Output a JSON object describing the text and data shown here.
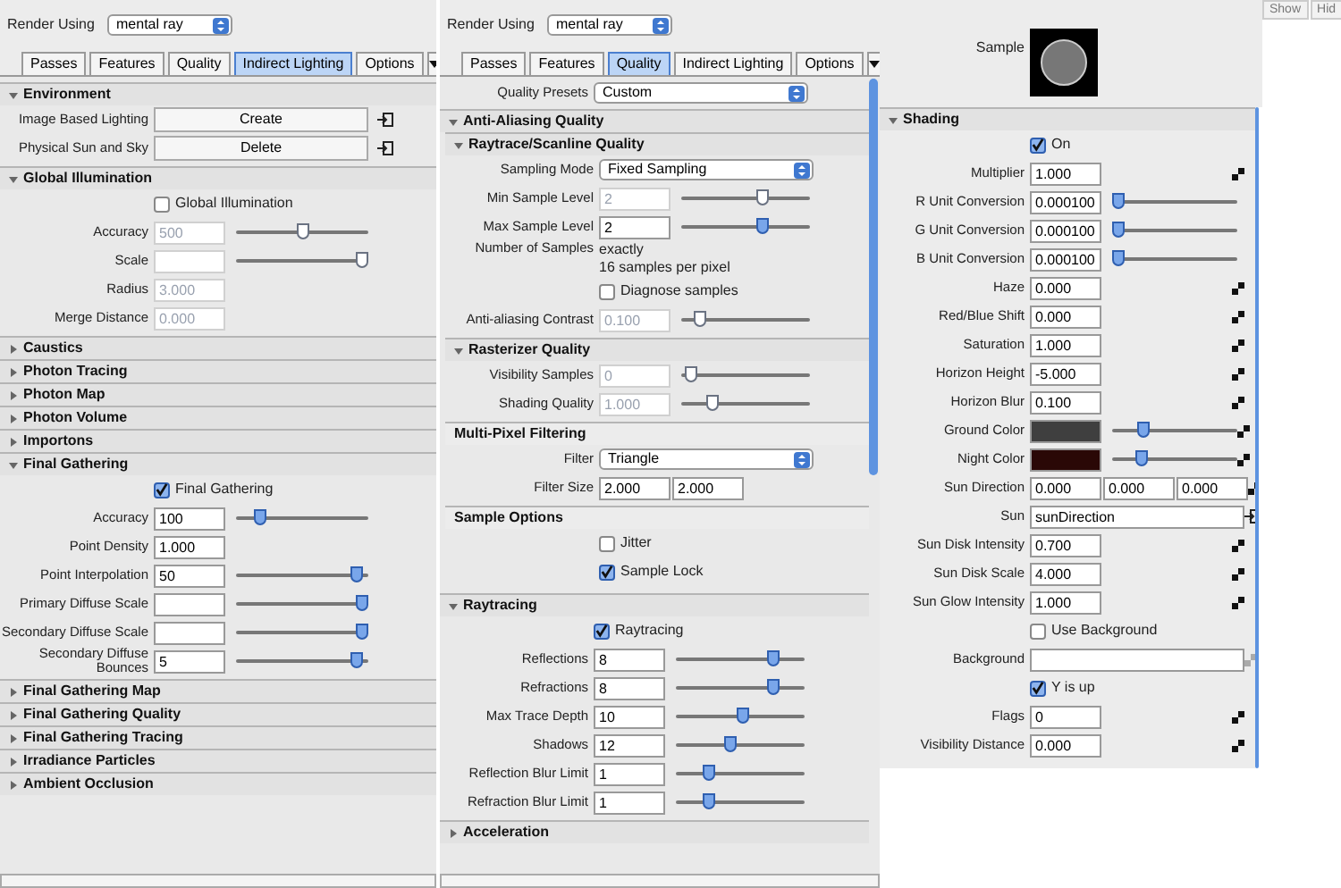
{
  "left": {
    "render_using": {
      "label": "Render Using",
      "value": "mental ray"
    },
    "tabs": [
      {
        "label": "Passes",
        "selected": false
      },
      {
        "label": "Features",
        "selected": false
      },
      {
        "label": "Quality",
        "selected": false
      },
      {
        "label": "Indirect Lighting",
        "selected": true
      },
      {
        "label": "Options",
        "selected": false
      }
    ],
    "sections": [
      {
        "kind": "rollout",
        "title": "Environment",
        "expanded": true,
        "rows": [
          {
            "kind": "button",
            "label": "Image Based Lighting",
            "value": "Create"
          },
          {
            "kind": "button",
            "label": "Physical Sun and Sky",
            "value": "Delete"
          }
        ]
      },
      {
        "kind": "rollout",
        "title": "Global Illumination",
        "expanded": true,
        "rows": [
          {
            "kind": "checkbox",
            "label": "Global Illumination",
            "checked": false
          },
          {
            "kind": "field",
            "label": "Accuracy",
            "value": "500",
            "disabled": true,
            "level": 0.5
          },
          {
            "kind": "field",
            "label": "Scale",
            "disabled": true,
            "level": 1
          },
          {
            "kind": "field",
            "label": "Radius",
            "value": "3.000",
            "disabled": true
          },
          {
            "kind": "field",
            "label": "Merge Distance",
            "value": "0.000",
            "disabled": true
          }
        ]
      },
      {
        "kind": "rollout",
        "title": "Caustics",
        "expanded": false
      },
      {
        "kind": "rollout",
        "title": "Photon Tracing",
        "expanded": false
      },
      {
        "kind": "rollout",
        "title": "Photon Map",
        "expanded": false
      },
      {
        "kind": "rollout",
        "title": "Photon Volume",
        "expanded": false
      },
      {
        "kind": "rollout",
        "title": "Importons",
        "expanded": false
      },
      {
        "kind": "rollout",
        "title": "Final Gathering",
        "expanded": true,
        "rows": [
          {
            "kind": "checkbox",
            "label": "Final Gathering",
            "checked": true
          },
          {
            "kind": "field",
            "label": "Accuracy",
            "value": "100",
            "disabled": false,
            "level": 0.15
          },
          {
            "kind": "field",
            "label": "Point Density",
            "value": "1.000",
            "disabled": false
          },
          {
            "kind": "field",
            "label": "Point Interpolation",
            "value": "50",
            "disabled": false,
            "level": 0.95
          },
          {
            "kind": "field",
            "label": "Primary Diffuse Scale",
            "disabled": false,
            "level": 1
          },
          {
            "kind": "field",
            "label": "Secondary Diffuse Scale",
            "disabled": false,
            "level": 1
          },
          {
            "kind": "field",
            "label": "Secondary Diffuse Bounces",
            "value": "5",
            "disabled": false,
            "level": 0.95
          }
        ]
      },
      {
        "kind": "rollout",
        "title": "Final Gathering Map",
        "expanded": false
      },
      {
        "kind": "rollout",
        "title": "Final Gathering Quality",
        "expanded": false
      },
      {
        "kind": "rollout",
        "title": "Final Gathering Tracing",
        "expanded": false
      },
      {
        "kind": "rollout",
        "title": "Irradiance Particles",
        "expanded": false
      },
      {
        "kind": "rollout",
        "title": "Ambient Occlusion",
        "expanded": false
      }
    ]
  },
  "middle": {
    "render_using": {
      "label": "Render Using",
      "value": "mental ray"
    },
    "tabs": [
      {
        "label": "Passes",
        "selected": false
      },
      {
        "label": "Features",
        "selected": false
      },
      {
        "label": "Quality",
        "selected": true
      },
      {
        "label": "Indirect Lighting",
        "selected": false
      },
      {
        "label": "Options",
        "selected": false
      }
    ],
    "presets": {
      "label": "Quality Presets",
      "value": "Custom"
    },
    "sections": [
      {
        "kind": "rollout",
        "title": "Anti-Aliasing Quality",
        "expanded": true,
        "children": [
          {
            "kind": "rollout",
            "title": "Raytrace/Scanline Quality",
            "expanded": true,
            "rows": [
              {
                "kind": "dropdown",
                "label": "Sampling Mode",
                "value": "Fixed Sampling"
              },
              {
                "kind": "field",
                "label": "Min Sample Level",
                "value": "2",
                "disabled": true,
                "level": 0.65
              },
              {
                "kind": "field",
                "label": "Max Sample Level",
                "value": "2",
                "disabled": false,
                "level": 0.65
              },
              {
                "kind": "text",
                "label": "Number of Samples",
                "value": "exactly\n16 samples per pixel"
              },
              {
                "kind": "checkbox",
                "label": "Diagnose samples",
                "checked": false
              },
              {
                "kind": "field",
                "label": "Anti-aliasing Contrast",
                "value": "0.100",
                "disabled": true,
                "level": 0.1
              }
            ]
          },
          {
            "kind": "rollout",
            "title": "Rasterizer Quality",
            "expanded": true,
            "rows": [
              {
                "kind": "field",
                "label": "Visibility Samples",
                "value": "0",
                "disabled": true,
                "level": 0.03
              },
              {
                "kind": "field",
                "label": "Shading Quality",
                "value": "1.000",
                "disabled": true,
                "level": 0.22
              }
            ]
          },
          {
            "kind": "frame",
            "title": "Multi-Pixel Filtering",
            "rows": [
              {
                "kind": "dropdown",
                "label": "Filter",
                "value": "Triangle"
              },
              {
                "kind": "fields",
                "label": "Filter Size",
                "values": [
                  "2.000",
                  "2.000"
                ]
              }
            ]
          },
          {
            "kind": "frame",
            "title": "Sample Options",
            "rows": [
              {
                "kind": "checkbox",
                "label": "Jitter",
                "checked": false
              },
              {
                "kind": "checkbox",
                "label": "Sample Lock",
                "checked": true
              }
            ]
          }
        ]
      },
      {
        "kind": "rollout",
        "title": "Raytracing",
        "expanded": true,
        "rows": [
          {
            "kind": "checkbox",
            "label": "Raytracing",
            "checked": true
          },
          {
            "kind": "field",
            "label": "Reflections",
            "value": "8",
            "disabled": false,
            "level": 0.78
          },
          {
            "kind": "field",
            "label": "Refractions",
            "value": "8",
            "disabled": false,
            "level": 0.78
          },
          {
            "kind": "field",
            "label": "Max Trace Depth",
            "value": "10",
            "disabled": false,
            "level": 0.52
          },
          {
            "kind": "field",
            "label": "Shadows",
            "value": "12",
            "disabled": false,
            "level": 0.42
          },
          {
            "kind": "field",
            "label": "Reflection Blur Limit",
            "value": "1",
            "disabled": false,
            "level": 0.23
          },
          {
            "kind": "field",
            "label": "Refraction Blur Limit",
            "value": "1",
            "disabled": false,
            "level": 0.23
          }
        ]
      },
      {
        "kind": "rollout",
        "title": "Acceleration",
        "expanded": false
      }
    ]
  },
  "right": {
    "header_buttons": [
      "Show",
      "Hid"
    ],
    "sample_label": "Sample",
    "sections": [
      {
        "kind": "rollout",
        "title": "Shading",
        "expanded": true,
        "rows": [
          {
            "kind": "checkbox",
            "label": "On",
            "checked": true,
            "map": false
          },
          {
            "kind": "field",
            "label": "Multiplier",
            "value": "1.000",
            "map": true
          },
          {
            "kind": "field",
            "label": "R Unit Conversion",
            "value": "0.000100",
            "level": 0.0,
            "map": false
          },
          {
            "kind": "field",
            "label": "G Unit Conversion",
            "value": "0.000100",
            "level": 0.0,
            "map": false
          },
          {
            "kind": "field",
            "label": "B Unit Conversion",
            "value": "0.000100",
            "level": 0.0,
            "map": false
          },
          {
            "kind": "field",
            "label": "Haze",
            "value": "0.000",
            "map": true
          },
          {
            "kind": "field",
            "label": "Red/Blue Shift",
            "value": "0.000",
            "map": true
          },
          {
            "kind": "field",
            "label": "Saturation",
            "value": "1.000",
            "map": true
          },
          {
            "kind": "field",
            "label": "Horizon Height",
            "value": "-5.000",
            "map": true
          },
          {
            "kind": "field",
            "label": "Horizon Blur",
            "value": "0.100",
            "map": true
          },
          {
            "kind": "color",
            "label": "Ground Color",
            "color": "#3f3f3f",
            "level": 0.22,
            "map": true
          },
          {
            "kind": "color",
            "label": "Night Color",
            "color": "#2a0806",
            "level": 0.2,
            "map": true
          },
          {
            "kind": "fields",
            "label": "Sun Direction",
            "values": [
              "0.000",
              "0.000",
              "0.000"
            ],
            "map": true
          },
          {
            "kind": "link",
            "label": "Sun",
            "value": "sunDirection",
            "map": false
          },
          {
            "kind": "field",
            "label": "Sun Disk Intensity",
            "value": "0.700",
            "map": true
          },
          {
            "kind": "field",
            "label": "Sun Disk Scale",
            "value": "4.000",
            "map": true
          },
          {
            "kind": "field",
            "label": "Sun Glow Intensity",
            "value": "1.000",
            "map": true
          },
          {
            "kind": "checkbox",
            "label": "Use Background",
            "checked": false,
            "map": false
          },
          {
            "kind": "text_field",
            "label": "Background",
            "map": true
          },
          {
            "kind": "checkbox",
            "label": "Y is up",
            "checked": true,
            "map": false
          },
          {
            "kind": "field",
            "label": "Flags",
            "value": "0",
            "map": true
          },
          {
            "kind": "field",
            "label": "Visibility Distance",
            "value": "0.000",
            "map": true
          }
        ]
      }
    ]
  }
}
